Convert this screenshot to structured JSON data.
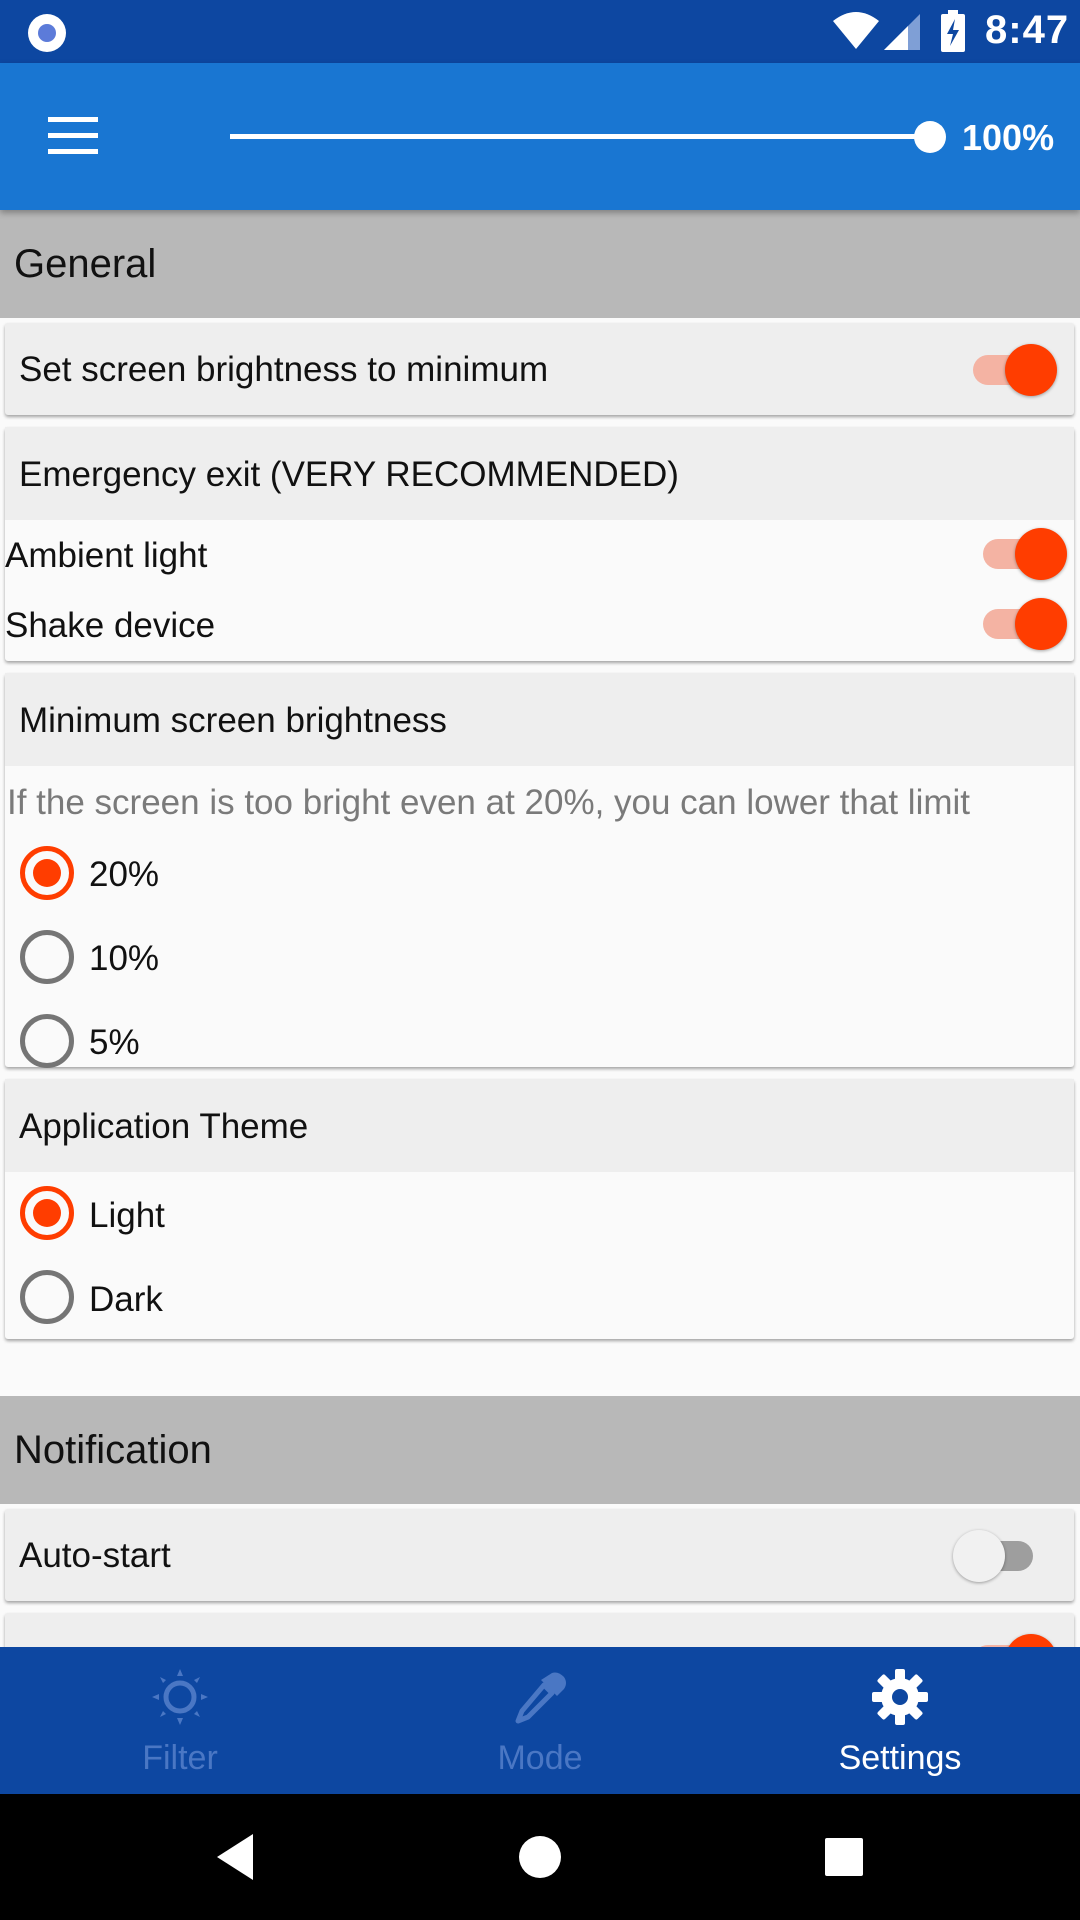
{
  "status_bar": {
    "time": "8:47",
    "icons": [
      "app-notification-icon",
      "wifi-icon",
      "cell-signal-icon",
      "battery-charging-icon"
    ]
  },
  "app_bar": {
    "menu_icon": "hamburger-menu-icon",
    "brightness_percent": 100,
    "brightness_label": "100%"
  },
  "sections": {
    "general": {
      "title": "General",
      "min_brightness_toggle": {
        "label": "Set screen brightness to minimum",
        "on": true
      },
      "emergency_exit": {
        "title": "Emergency exit (VERY RECOMMENDED)",
        "options": [
          {
            "label": "Ambient light",
            "on": true
          },
          {
            "label": "Shake device",
            "on": true
          }
        ]
      },
      "minimum_brightness": {
        "title": "Minimum screen brightness",
        "hint": "If the screen is too bright even at 20%, you can lower that limit",
        "options": [
          {
            "label": "20%",
            "selected": true
          },
          {
            "label": "10%",
            "selected": false
          },
          {
            "label": "5%",
            "selected": false
          }
        ]
      },
      "theme": {
        "title": "Application Theme",
        "options": [
          {
            "label": "Light",
            "selected": true
          },
          {
            "label": "Dark",
            "selected": false
          }
        ]
      }
    },
    "notification": {
      "title": "Notification",
      "auto_start": {
        "label": "Auto-start",
        "on": false
      }
    }
  },
  "bottom_nav": {
    "items": [
      {
        "label": "Filter",
        "icon": "brightness-filter-icon",
        "active": false
      },
      {
        "label": "Mode",
        "icon": "eyedropper-icon",
        "active": false
      },
      {
        "label": "Settings",
        "icon": "gear-icon",
        "active": true
      }
    ]
  },
  "system_nav": {
    "icons": [
      "back-icon",
      "home-icon",
      "recents-icon"
    ]
  },
  "colors": {
    "status_bar": "#0d47a1",
    "app_bar": "#1976d2",
    "accent": "#ff3d00",
    "section_header": "#b8b8b8",
    "card_title": "#eeeeee",
    "nav_inactive": "#4a77c4"
  }
}
